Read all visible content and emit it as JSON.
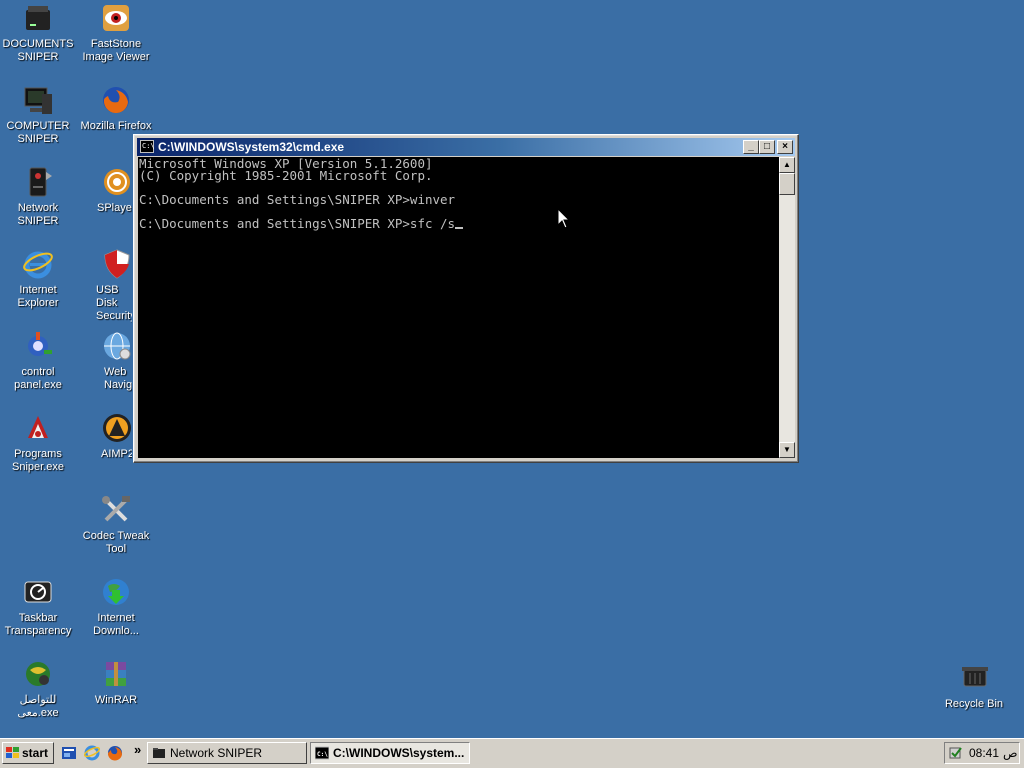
{
  "desktop": {
    "icons": [
      {
        "id": "documents-sniper",
        "label": "DOCUMENTS\nSNIPER",
        "icon": "hard-drive-icon"
      },
      {
        "id": "faststone",
        "label": "FastStone\nImage Viewer",
        "icon": "faststone-eye-icon"
      },
      {
        "id": "computer-sniper",
        "label": "COMPUTER\nSNIPER",
        "icon": "computer-icon"
      },
      {
        "id": "firefox",
        "label": "Mozilla Firefox",
        "icon": "firefox-icon"
      },
      {
        "id": "network-sniper",
        "label": "Network\nSNIPER",
        "icon": "network-drive-icon"
      },
      {
        "id": "splayer",
        "label": "SPlayer",
        "icon": "splayer-icon"
      },
      {
        "id": "internet-explorer",
        "label": "Internet\nExplorer",
        "icon": "internet-explorer-icon"
      },
      {
        "id": "usb-disk-security",
        "label": "USB Disk\nSecurity",
        "icon": "shield-icon"
      },
      {
        "id": "control-panel",
        "label": "control\npanel.exe",
        "icon": "control-panel-icon"
      },
      {
        "id": "web-navigator",
        "label": "Web\nNavigator",
        "icon": "globe-icon"
      },
      {
        "id": "programs-sniper",
        "label": "Programs\nSniper.exe",
        "icon": "programs-icon"
      },
      {
        "id": "aimp2",
        "label": "AIMP2",
        "icon": "aimp-icon"
      },
      {
        "id": "codec-tweak",
        "label": "Codec Tweak\nTool",
        "icon": "tools-icon"
      },
      {
        "id": "taskbar-transparency",
        "label": "Taskbar\nTransparency",
        "icon": "taskbar-gauge-icon"
      },
      {
        "id": "internet-download",
        "label": "Internet\nDownlo...",
        "icon": "download-globe-icon"
      },
      {
        "id": "contact-exe",
        "label": "للتواصل\nمعى.exe",
        "icon": "globe-user-icon"
      },
      {
        "id": "winrar",
        "label": "WinRAR",
        "icon": "winrar-icon"
      },
      {
        "id": "recycle-bin",
        "label": "Recycle Bin",
        "icon": "recycle-bin-icon"
      }
    ]
  },
  "cmd_window": {
    "title": "C:\\WINDOWS\\system32\\cmd.exe",
    "icon_text": "C:\\",
    "controls": {
      "minimize": "_",
      "maximize": "□",
      "close": "×"
    },
    "lines": [
      "Microsoft Windows XP [Version 5.1.2600]",
      "(C) Copyright 1985-2001 Microsoft Corp.",
      "",
      "C:\\Documents and Settings\\SNIPER XP>winver",
      "",
      "C:\\Documents and Settings\\SNIPER XP>sfc /s"
    ],
    "scroll": {
      "up": "▲",
      "down": "▼"
    }
  },
  "taskbar": {
    "start_label": "start",
    "quick_launch": [
      "explorer-icon",
      "internet-explorer-icon",
      "firefox-icon"
    ],
    "overflow": "»",
    "tasks": [
      {
        "label": "Network SNIPER",
        "icon": "folder-icon"
      },
      {
        "label": "C:\\WINDOWS\\system...",
        "icon": "cmd-icon",
        "active": true
      }
    ],
    "tray": {
      "time": "08:41",
      "ampm": "ص",
      "icon": "tray-app-icon"
    }
  },
  "colors": {
    "desktop": "#3a6ea5",
    "title_active": "#0a246a",
    "console_bg": "#000000",
    "console_fg": "#c0c0c0"
  }
}
